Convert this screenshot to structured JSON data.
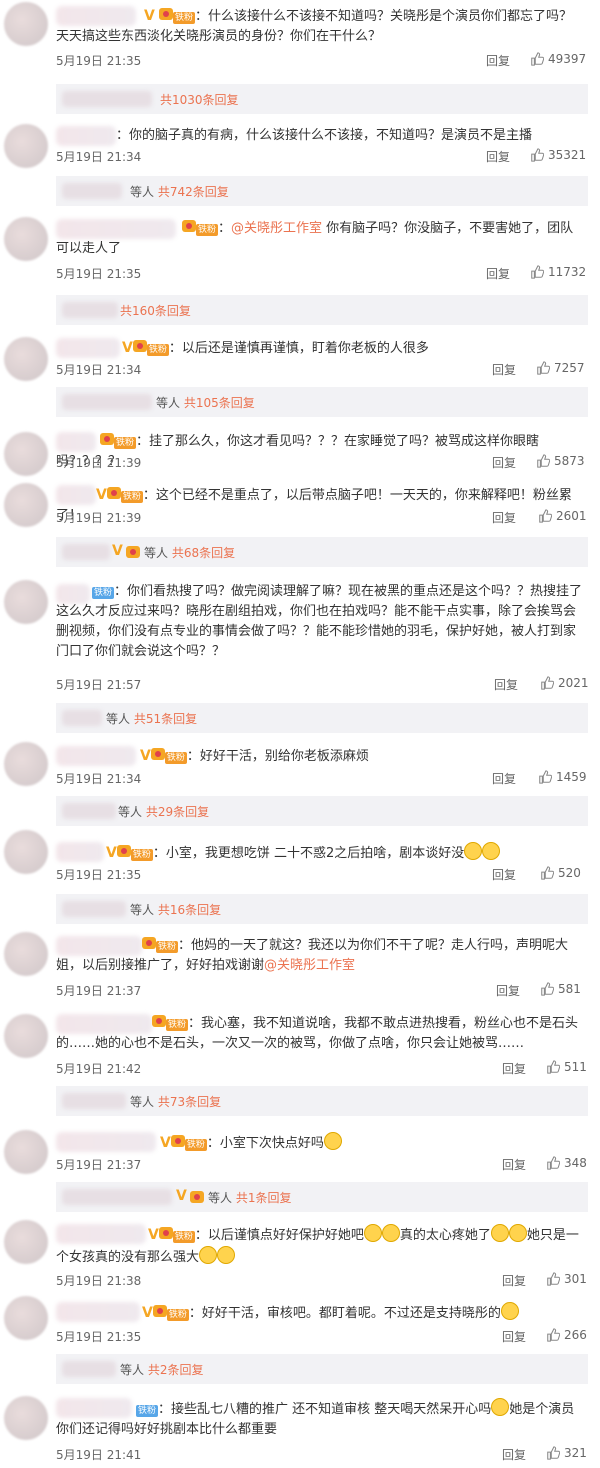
{
  "icons": {
    "like": "thumbs-up-icon",
    "vip": "v-badge-icon",
    "crown": "crown-icon",
    "emoji": "emoji-face-icon"
  },
  "colors": {
    "link": "#eb7350",
    "badge": "#f39b2a",
    "badge_blue": "#57a6e8",
    "sub_bg": "#f2f2f5"
  },
  "reply_label": "回复",
  "comments": [
    {
      "text": "：什么该接什么不该接不知道吗？关晓彤是个演员你们都忘了吗？天天搞这些东西淡化关晓彤演员的身份？你们在干什么？",
      "time": "5月19日 21:35",
      "likes": "49397",
      "badge": "铁粉",
      "sub_prefix": "",
      "sub_count": "共1030条回复"
    },
    {
      "text": "：你的脑子真的有病，什么该接什么不该接，不知道吗？是演员不是主播",
      "time": "5月19日 21:34",
      "likes": "35321",
      "badge": "",
      "sub_prefix": "等人",
      "sub_count": "共742条回复"
    },
    {
      "mention": "@关晓彤工作室",
      "text_before": "：",
      "text": " 你有脑子吗？你没脑子，不要害她了，团队可以走人了",
      "time": "5月19日 21:35",
      "likes": "11732",
      "badge": "铁粉",
      "sub_prefix": "",
      "sub_count": "共160条回复"
    },
    {
      "text": "：以后还是谨慎再谨慎，盯着你老板的人很多",
      "time": "5月19日 21:34",
      "likes": "7257",
      "badge": "铁粉",
      "sub_prefix": "等人",
      "sub_count": "共105条回复"
    },
    {
      "text": "：挂了那么久，你这才看见吗？？？在家睡觉了吗？被骂成这样你眼瞎吗？？？？",
      "time": "5月19日 21:39",
      "likes": "5873",
      "badge": "铁粉",
      "sub_prefix": "",
      "sub_count": ""
    },
    {
      "text": "：这个已经不是重点了，以后带点脑子吧！一天天的，你来解释吧！粉丝累了！",
      "time": "5月19日 21:39",
      "likes": "2601",
      "badge": "铁粉",
      "sub_prefix": "等人",
      "sub_count": "共68条回复"
    },
    {
      "text": "：你们看热搜了吗？做完阅读理解了嘛？现在被黑的重点还是这个吗？？热搜挂了这么久才反应过来吗？晓彤在剧组拍戏，你们也在拍戏吗？能不能干点实事，除了会挨骂会删视频，你们没有点专业的事情会做了吗？？能不能珍惜她的羽毛，保护好她，被人打到家门口了你们就会说这个吗？？",
      "time": "5月19日 21:57",
      "likes": "2021",
      "badge": "铁粉",
      "sub_prefix": "等人",
      "sub_count": "共51条回复"
    },
    {
      "text": "：好好干活，别给你老板添麻烦",
      "time": "5月19日 21:34",
      "likes": "1459",
      "badge": "铁粉",
      "sub_prefix": "等人",
      "sub_count": "共29条回复"
    },
    {
      "text": "：小室，我更想吃饼 二十不惑2之后拍啥，剧本谈好没",
      "time": "5月19日 21:35",
      "likes": "520",
      "badge": "铁粉",
      "sub_prefix": "等人",
      "sub_count": "共16条回复"
    },
    {
      "text": "：他妈的一天了就这？我还以为你们不干了呢？走人行吗，声明呢大姐，以后别接推广了，好好拍戏谢谢",
      "mention": "@关晓彤工作室",
      "time": "5月19日 21:37",
      "likes": "581",
      "badge": "铁粉",
      "sub_prefix": "",
      "sub_count": ""
    },
    {
      "text": "：我心塞，我不知道说啥，我都不敢点进热搜看，粉丝心也不是石头的……她的心也不是石头，一次又一次的被骂，你做了点啥，你只会让她被骂……",
      "time": "5月19日 21:42",
      "likes": "511",
      "badge": "铁粉",
      "sub_prefix": "等人",
      "sub_count": "共73条回复"
    },
    {
      "text": "：小室下次快点好吗",
      "time": "5月19日 21:37",
      "likes": "348",
      "badge": "铁粉",
      "sub_prefix": "等人",
      "sub_count": "共1条回复"
    },
    {
      "text": "：以后谨慎点好好保护好她吧",
      "text2": "真的太心疼她了",
      "text3": "她只是一个女孩真的没有那么强大",
      "time": "5月19日 21:38",
      "likes": "301",
      "badge": "铁粉",
      "sub_prefix": "",
      "sub_count": ""
    },
    {
      "text": "：好好干活，审核吧。都盯着呢。不过还是支持晓彤的",
      "time": "5月19日 21:35",
      "likes": "266",
      "badge": "铁粉",
      "sub_prefix": "等人",
      "sub_count": "共2条回复"
    },
    {
      "text": "：接些乱七八糟的推广 还不知道审核 整天喝天然呆开心吗",
      "text2": "她是个演员 你们还记得吗好好挑剧本比什么都重要",
      "time": "5月19日 21:41",
      "likes": "321",
      "badge": "铁粉",
      "sub_prefix": "",
      "sub_count": ""
    }
  ]
}
